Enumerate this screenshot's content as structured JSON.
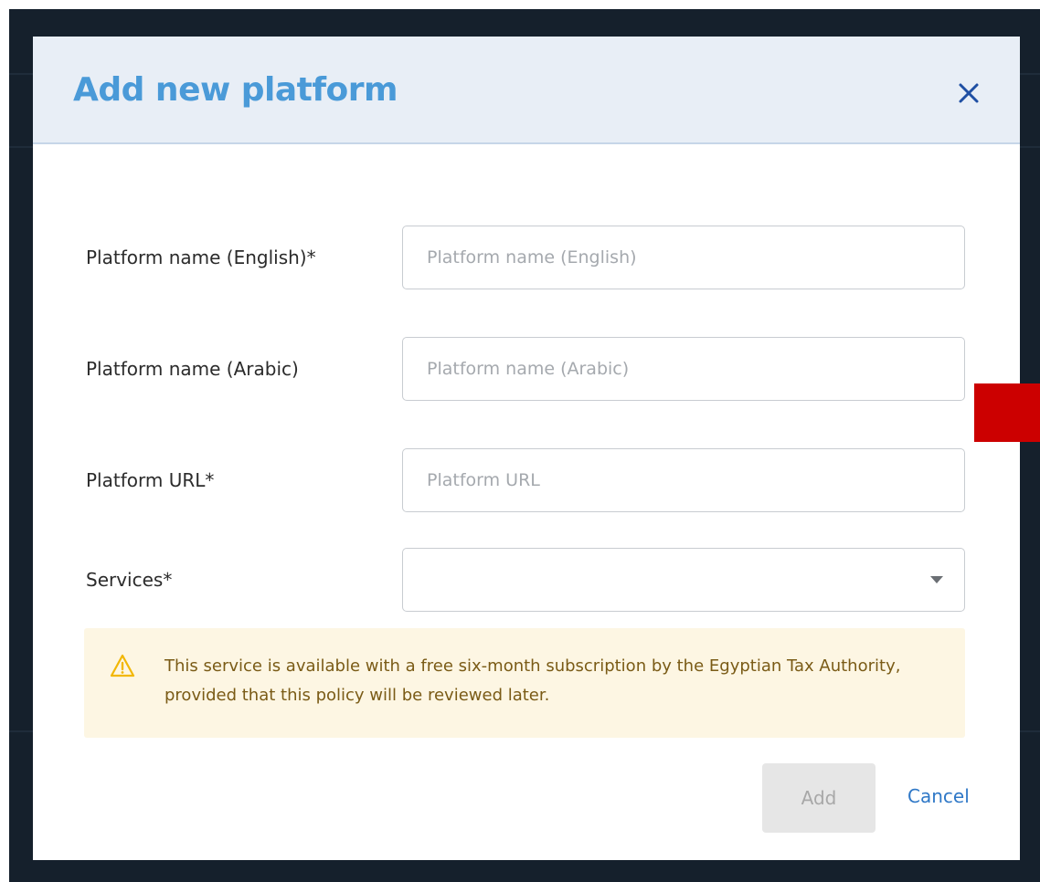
{
  "modal": {
    "title": "Add new platform",
    "close_icon": "close-icon"
  },
  "form": {
    "name_en": {
      "label": "Platform name (English)*",
      "placeholder": "Platform name (English)",
      "value": ""
    },
    "name_ar": {
      "label": "Platform name (Arabic)",
      "placeholder": "Platform name (Arabic)",
      "value": ""
    },
    "url": {
      "label": "Platform URL*",
      "placeholder": "Platform URL",
      "value": ""
    },
    "services": {
      "label": "Services*",
      "value": "",
      "arrow_icon": "caret-down-icon"
    }
  },
  "notice": {
    "icon": "warning-icon",
    "text": "This service is available with a free six-month subscription by the Egyptian Tax Authority, provided that this policy will be reviewed later."
  },
  "actions": {
    "add_label": "Add",
    "cancel_label": "Cancel"
  },
  "colors": {
    "title": "#4a9ad8",
    "header_bg": "#e8eef6",
    "close_icon": "#1f4fa3",
    "notice_bg": "#fdf6e3",
    "notice_text": "#7a5b16",
    "warning_icon": "#f2b705",
    "link": "#2f78c7",
    "disabled_button_bg": "#e6e6e6",
    "backdrop": "#15202c",
    "marker": "#cc0000"
  }
}
